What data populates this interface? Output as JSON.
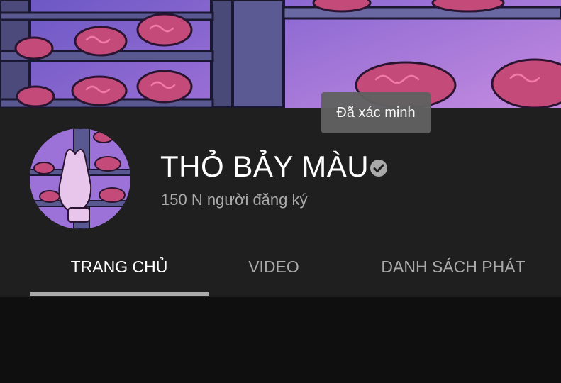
{
  "channel": {
    "name": "THỎ BẢY MÀU",
    "subscribers": "150 N người đăng ký",
    "verified_tooltip": "Đã xác minh"
  },
  "tabs": [
    {
      "label": "TRANG CHỦ",
      "active": true
    },
    {
      "label": "VIDEO",
      "active": false
    },
    {
      "label": "DANH SÁCH PHÁT",
      "active": false
    }
  ],
  "colors": {
    "header_bg": "#1f1f1f",
    "page_bg": "#0f0f0f",
    "text_primary": "#ffffff",
    "text_secondary": "#aaaaaa",
    "tooltip_bg": "#616161"
  },
  "icons": {
    "verified": "check-circle-icon"
  }
}
